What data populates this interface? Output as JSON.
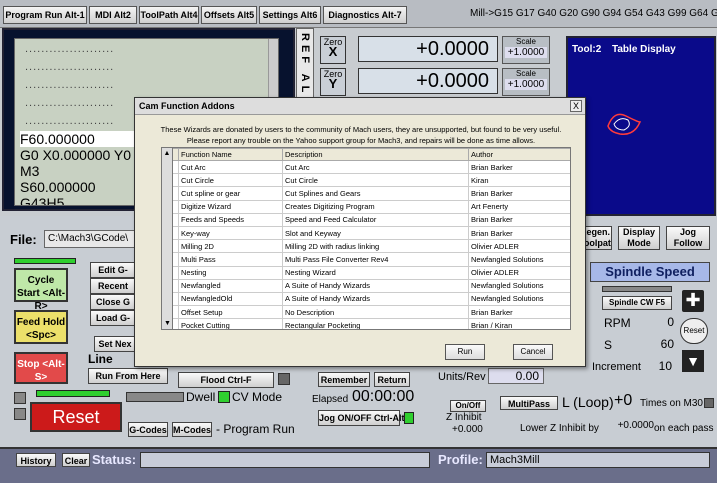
{
  "tabs": [
    "Program Run Alt-1",
    "MDI Alt2",
    "ToolPath Alt4",
    "Offsets Alt5",
    "Settings Alt6",
    "Diagnostics Alt-7"
  ],
  "gcode_status": "Mill->G15  G17 G40 G20 G90 G94 G54 G43 G99 G64 G97",
  "gcode_panel": {
    "lines": [
      "F60.000000",
      "G0 X0.000000 Y0",
      "M3",
      "S60.000000",
      "G43H5"
    ],
    "placeholder_rows": [
      "......................",
      "......................",
      "......................",
      "......................",
      "......................"
    ]
  },
  "ref": "REF ALL",
  "dro": [
    {
      "axis": "X",
      "zero_label": "Zero",
      "value": "+0.0000",
      "scale_label": "Scale",
      "scale_value": "+1.0000"
    },
    {
      "axis": "Y",
      "zero_label": "Zero",
      "value": "+0.0000",
      "scale_label": "Scale",
      "scale_value": "+1.0000"
    }
  ],
  "toolpath": {
    "tool": "Tool:2",
    "title": "Table Display"
  },
  "file": {
    "label": "File:",
    "path": "C:\\Mach3\\GCode\\"
  },
  "right_buttons": {
    "regen": "Regen. Toolpath",
    "display_mode": "Display Mode",
    "jog_follow": "Jog Follow"
  },
  "left_buttons": {
    "cycle_start": "Cycle Start <Alt-R>",
    "feed_hold": "Feed Hold <Spc>",
    "stop": "Stop <Alt-S>",
    "edit": "Edit G-",
    "recent": "Recent",
    "close": "Close G",
    "load": "Load G-",
    "set_next": "Set Nex",
    "line_label": "Line",
    "run_from_here": "Run From Here",
    "flood": "Flood Ctrl-F",
    "reset": "Reset",
    "dwell": "Dwell",
    "cv_mode": "CV Mode",
    "gcodes": "G-Codes",
    "mcodes": "M-Codes",
    "program_run": "- Program Run"
  },
  "center": {
    "remember": "Remember",
    "return": "Return",
    "elapsed_label": "Elapsed",
    "elapsed": "00:00:00",
    "jog": "Jog ON/OFF Ctrl-Alt-J",
    "units_rev_label": "Units/Rev",
    "units_rev": "0.00",
    "onoff": "On/Off",
    "z_inhibit": "Z Inhibit",
    "z_inhibit_value": "+0.000",
    "multipass": "MultiPass",
    "loop_label": "L (Loop)",
    "loop_value": "+0",
    "times_label": "Times on M30",
    "lower_z_label": "Lower Z Inhibit by",
    "lower_z_value": "+0.0000",
    "each_pass": "on each pass"
  },
  "spindle": {
    "title": "Spindle Speed",
    "cw": "Spindle CW F5",
    "rpm_label": "RPM",
    "rpm": "0",
    "s_label": "S",
    "s": "60",
    "increment_label": "Increment",
    "increment": "10",
    "reset": "Reset"
  },
  "status": {
    "history": "History",
    "clear": "Clear",
    "status_label": "Status:",
    "profile_label": "Profile:",
    "profile": "Mach3Mill"
  },
  "dialog": {
    "title": "Cam Function Addons",
    "intro_1": "These Wizards are donated by users to the community of Mach users, they are unsupported, but found to be very useful.",
    "intro_2": "Please report any trouble on the Yahoo support group for Mach3, and repairs will be done as time allows.",
    "columns": [
      "Function Name",
      "Description",
      "Author"
    ],
    "rows": [
      [
        "Cut Arc",
        "Cut Arc",
        "Brian Barker"
      ],
      [
        "Cut Circle",
        "Cut Circle",
        "Kiran"
      ],
      [
        "Cut spline or gear",
        "Cut Splines and Gears",
        "Brian Barker"
      ],
      [
        "Digitize Wizard",
        "Creates Digitizing Program",
        "Art Fenerty"
      ],
      [
        "Feeds and Speeds",
        "Speed and Feed Calculator",
        "Brian Barker"
      ],
      [
        "Key-way",
        "Slot and Keyway",
        "Brian Barker"
      ],
      [
        "Milling 2D",
        "Milling 2D with radius linking",
        "Olivier ADLER"
      ],
      [
        "Multi Pass",
        "Multi Pass File Converter Rev4",
        "Newfangled Solutions"
      ],
      [
        "Nesting",
        "Nesting Wizard",
        "Olivier ADLER"
      ],
      [
        "Newfangled",
        "A Suite of Handy Wizards",
        "Newfangled Solutions"
      ],
      [
        "NewfangledOld",
        "A Suite of Handy Wizards",
        "Newfangled Solutions"
      ],
      [
        "Offset Setup",
        "No Description",
        "Brian Barker"
      ],
      [
        "Pocket Cutting",
        "Rectangular Pocketing",
        "Brian / Kiran"
      ]
    ],
    "run": "Run",
    "cancel": "Cancel",
    "close": "X"
  },
  "colors": {
    "toolpath_bg": "#0a0a8a",
    "gpanel_bg": "#07122e",
    "led_green": "#2fcf2f",
    "reset_red": "#cc1a1a"
  }
}
